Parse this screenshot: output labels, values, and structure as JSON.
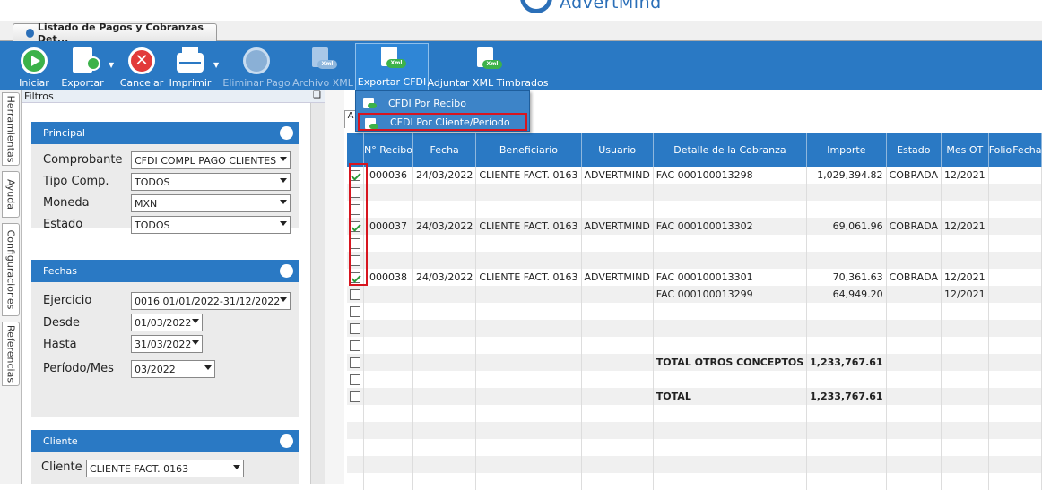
{
  "brand": {
    "logo_text": "AdvertMind"
  },
  "document_tab": {
    "title": "Listado de Pagos y Cobranzas Det..."
  },
  "toolbar": {
    "iniciar": "Iniciar",
    "exportar": "Exportar",
    "cancelar": "Cancelar",
    "imprimir": "Imprimir",
    "eliminar_pago": "Eliminar Pago",
    "archivo_xml": "Archivo XML",
    "exportar_cfdi": "Exportar CFDI",
    "adjuntar_xml": "Adjuntar XML Timbrados",
    "xml_badge": "Xml"
  },
  "dropdown": {
    "items": [
      "CFDI Por Recibo",
      "CFDI Por Cliente/Período"
    ],
    "highlighted_index": 1
  },
  "vertical_tabs": [
    "Herramientas",
    "Ayuda",
    "Configuraciones",
    "Referencias"
  ],
  "filters": {
    "title": "Filtros",
    "pin": "❑",
    "principal": {
      "title": "Principal",
      "comprobante_label": "Comprobante",
      "comprobante_value": "CFDI COMPL PAGO CLIENTES",
      "tipo_label": "Tipo Comp.",
      "tipo_value": "TODOS",
      "moneda_label": "Moneda",
      "moneda_value": "MXN",
      "estado_label": "Estado",
      "estado_value": "TODOS"
    },
    "fechas": {
      "title": "Fechas",
      "ejercicio_label": "Ejercicio",
      "ejercicio_value": "0016 01/01/2022-31/12/2022",
      "desde_label": "Desde",
      "desde_value": "01/03/2022",
      "hasta_label": "Hasta",
      "hasta_value": "31/03/2022",
      "periodo_label": "Período/Mes",
      "periodo_value": "03/2022"
    },
    "cliente": {
      "title": "Cliente",
      "cliente_label": "Cliente",
      "cliente_value": "CLIENTE FACT. 0163"
    }
  },
  "grid": {
    "tab_label": "A",
    "columns": [
      "",
      "N° Recibo",
      "Fecha",
      "Beneficiario",
      "Usuario",
      "Detalle de la Cobranza",
      "Importe",
      "Estado",
      "Mes OT",
      "Folio",
      "Fecha"
    ],
    "rows": [
      {
        "checked": true,
        "recibo": "000036",
        "fecha": "24/03/2022",
        "beneficiario": "CLIENTE FACT. 0163",
        "usuario": "ADVERTMIND",
        "detalle": "FAC 000100013298",
        "importe": "1,029,394.82",
        "estado": "COBRADA",
        "mes": "12/2021"
      },
      {
        "checked": false,
        "recibo": "",
        "fecha": "",
        "beneficiario": "",
        "usuario": "",
        "detalle": "",
        "importe": "",
        "estado": "",
        "mes": ""
      },
      {
        "checked": false,
        "recibo": "",
        "fecha": "",
        "beneficiario": "",
        "usuario": "",
        "detalle": "",
        "importe": "",
        "estado": "",
        "mes": ""
      },
      {
        "checked": true,
        "recibo": "000037",
        "fecha": "24/03/2022",
        "beneficiario": "CLIENTE FACT. 0163",
        "usuario": "ADVERTMIND",
        "detalle": "FAC 000100013302",
        "importe": "69,061.96",
        "estado": "COBRADA",
        "mes": "12/2021"
      },
      {
        "checked": false,
        "recibo": "",
        "fecha": "",
        "beneficiario": "",
        "usuario": "",
        "detalle": "",
        "importe": "",
        "estado": "",
        "mes": ""
      },
      {
        "checked": false,
        "recibo": "",
        "fecha": "",
        "beneficiario": "",
        "usuario": "",
        "detalle": "",
        "importe": "",
        "estado": "",
        "mes": ""
      },
      {
        "checked": true,
        "recibo": "000038",
        "fecha": "24/03/2022",
        "beneficiario": "CLIENTE FACT. 0163",
        "usuario": "ADVERTMIND",
        "detalle": "FAC 000100013301",
        "importe": "70,361.63",
        "estado": "COBRADA",
        "mes": "12/2021"
      },
      {
        "checked": false,
        "recibo": "",
        "fecha": "",
        "beneficiario": "",
        "usuario": "",
        "detalle": "FAC 000100013299",
        "importe": "64,949.20",
        "estado": "",
        "mes": "12/2021"
      },
      {
        "checked": false,
        "recibo": "",
        "fecha": "",
        "beneficiario": "",
        "usuario": "",
        "detalle": "",
        "importe": "",
        "estado": "",
        "mes": ""
      },
      {
        "checked": false,
        "recibo": "",
        "fecha": "",
        "beneficiario": "",
        "usuario": "",
        "detalle": "",
        "importe": "",
        "estado": "",
        "mes": ""
      },
      {
        "checked": false,
        "recibo": "",
        "fecha": "",
        "beneficiario": "",
        "usuario": "",
        "detalle": "",
        "importe": "",
        "estado": "",
        "mes": ""
      },
      {
        "checked": false,
        "recibo": "",
        "fecha": "",
        "beneficiario": "",
        "usuario": "",
        "detalle": "TOTAL OTROS CONCEPTOS",
        "importe": "1,233,767.61",
        "estado": "",
        "mes": "",
        "bold": true
      },
      {
        "checked": false,
        "recibo": "",
        "fecha": "",
        "beneficiario": "",
        "usuario": "",
        "detalle": "",
        "importe": "",
        "estado": "",
        "mes": ""
      },
      {
        "checked": false,
        "recibo": "",
        "fecha": "",
        "beneficiario": "",
        "usuario": "",
        "detalle": "TOTAL",
        "importe": "1,233,767.61",
        "estado": "",
        "mes": "",
        "bold": true
      },
      {
        "nocheck": true
      },
      {
        "nocheck": true
      },
      {
        "nocheck": true
      },
      {
        "nocheck": true
      },
      {
        "nocheck": true
      }
    ]
  },
  "colors": {
    "accent": "#2a79c4",
    "highlight": "#d7151f",
    "check": "#2a9a3a"
  }
}
